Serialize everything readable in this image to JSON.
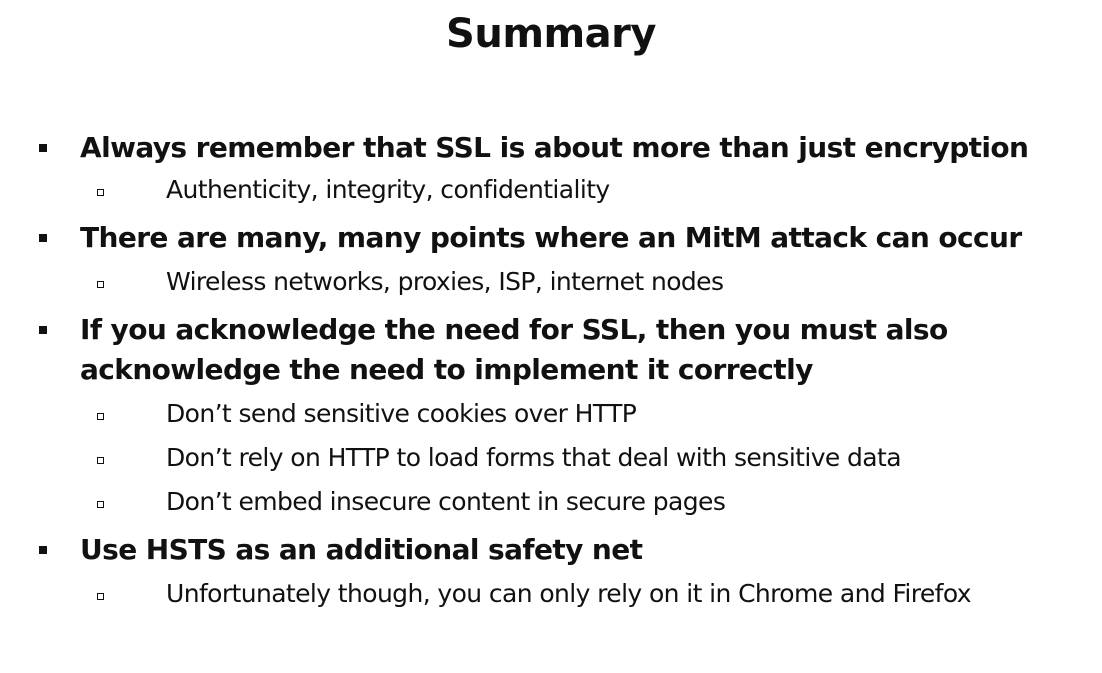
{
  "slide": {
    "title": "Summary",
    "bullets": [
      {
        "text": "Always remember that SSL is about more than just encryption",
        "subs": [
          "Authenticity, integrity, confidentiality"
        ]
      },
      {
        "text": "There are many, many points where an MitM attack can occur",
        "subs": [
          "Wireless networks, proxies, ISP, internet nodes"
        ]
      },
      {
        "text": "If you acknowledge the need for SSL, then you must also acknowledge the need to implement it correctly",
        "subs": [
          "Don’t send sensitive cookies over HTTP",
          "Don’t rely on HTTP to load forms that deal with sensitive data",
          "Don’t embed insecure content in secure pages"
        ]
      },
      {
        "text": "Use HSTS as an additional safety net",
        "subs": [
          "Unfortunately though, you can only rely on it in Chrome and Firefox"
        ]
      }
    ]
  }
}
